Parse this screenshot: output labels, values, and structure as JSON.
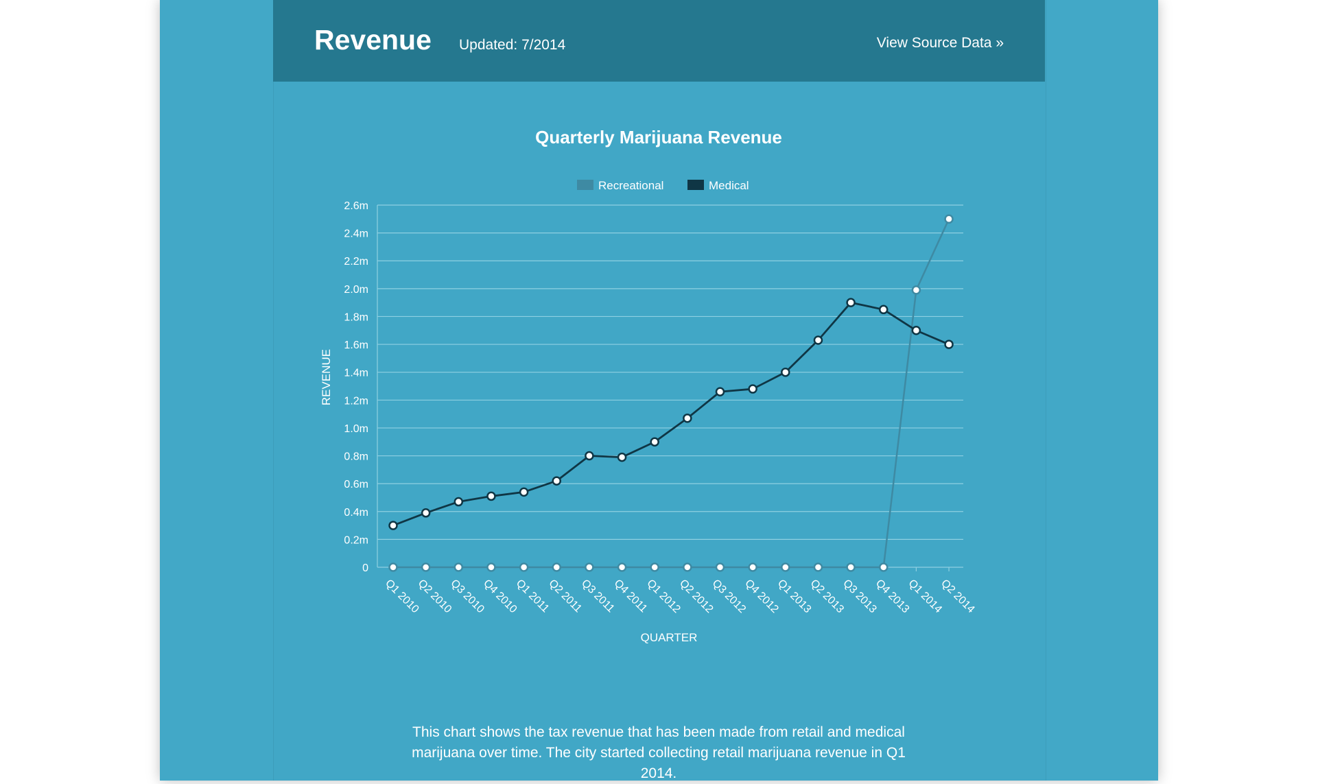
{
  "header": {
    "title": "Revenue",
    "updated": "Updated: 7/2014",
    "source_link": "View Source Data »"
  },
  "description": "This chart shows the tax revenue that has been made from retail and medical marijuana over time. The city started collecting retail marijuana revenue in Q1 2014.",
  "colors": {
    "background": "#42a8c7",
    "header": "#25788f",
    "recreational": "#3e8aa3",
    "medical": "#0f3645",
    "grid": "#8fd0e2"
  },
  "chart_data": {
    "type": "line",
    "title": "Quarterly Marijuana Revenue",
    "xlabel": "QUARTER",
    "ylabel": "REVENUE",
    "ylim": [
      0,
      2600000
    ],
    "yticks": [
      0,
      200000,
      400000,
      600000,
      800000,
      1000000,
      1200000,
      1400000,
      1600000,
      1800000,
      2000000,
      2200000,
      2400000,
      2600000
    ],
    "ytick_labels": [
      "0",
      "0.2m",
      "0.4m",
      "0.6m",
      "0.8m",
      "1.0m",
      "1.2m",
      "1.4m",
      "1.6m",
      "1.8m",
      "2.0m",
      "2.2m",
      "2.4m",
      "2.6m"
    ],
    "categories": [
      "Q1 2010",
      "Q2 2010",
      "Q3 2010",
      "Q4 2010",
      "Q1 2011",
      "Q2 2011",
      "Q3 2011",
      "Q4 2011",
      "Q1 2012",
      "Q2 2012",
      "Q3 2012",
      "Q4 2012",
      "Q1 2013",
      "Q2 2013",
      "Q3 2013",
      "Q4 2013",
      "Q1 2014",
      "Q2 2014"
    ],
    "legend_position": "top",
    "grid": true,
    "series": [
      {
        "name": "Recreational",
        "color": "#3e8aa3",
        "values": [
          0,
          0,
          0,
          0,
          0,
          0,
          0,
          0,
          0,
          0,
          0,
          0,
          0,
          0,
          0,
          0,
          1990000,
          2500000
        ]
      },
      {
        "name": "Medical",
        "color": "#0f3645",
        "values": [
          300000,
          390000,
          470000,
          510000,
          540000,
          620000,
          800000,
          790000,
          900000,
          1070000,
          1260000,
          1280000,
          1400000,
          1630000,
          1900000,
          1850000,
          1700000,
          1600000
        ]
      }
    ]
  }
}
